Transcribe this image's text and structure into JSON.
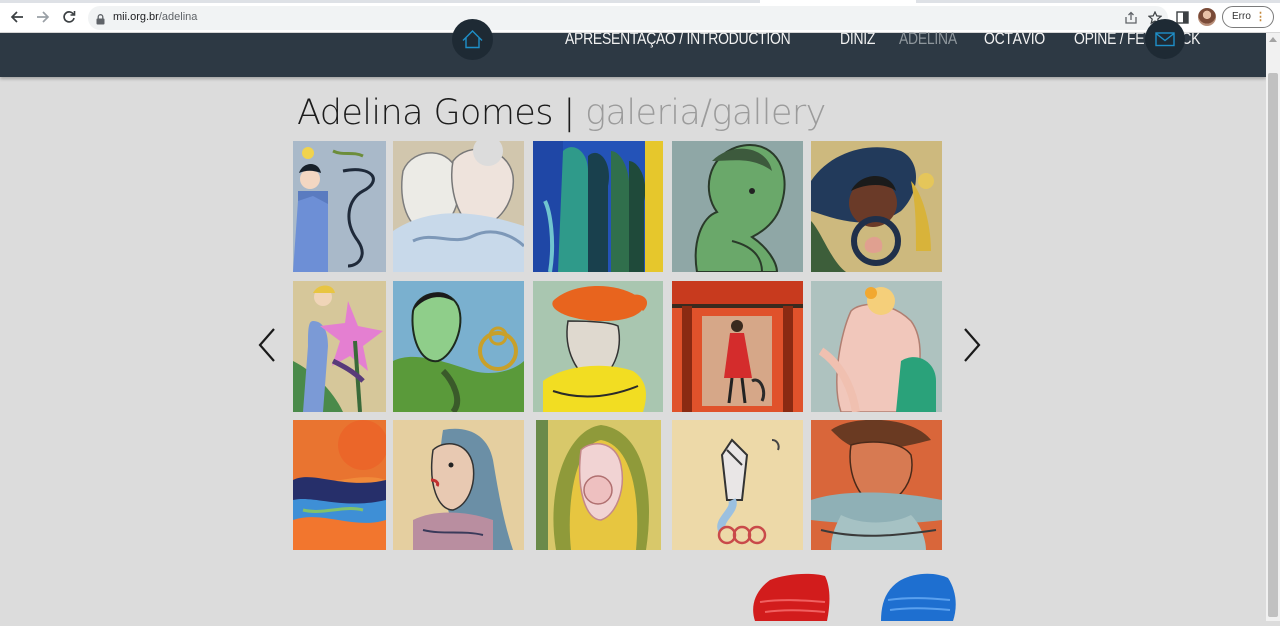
{
  "browser": {
    "url_host": "mii.org.br",
    "url_path": "/adelina",
    "error_label": "Erro"
  },
  "nav": {
    "links": [
      {
        "label": "APRESENTAÇÃO / INTRODUCTION",
        "active": false
      },
      {
        "label": "DINIZ",
        "active": false
      },
      {
        "label": "ADELINA",
        "active": true
      },
      {
        "label": "OCTÁVIO",
        "active": false
      },
      {
        "label": "OPINE / FEEDBACK",
        "active": false
      }
    ]
  },
  "page": {
    "title_name": "Adelina Gomes",
    "title_separator": "|",
    "title_gallery": "galeria/gallery"
  },
  "gallery": {
    "paintings": [
      "painting-woman-blue-dress",
      "painting-two-pale-faces",
      "painting-blue-green-figures",
      "painting-green-profile",
      "painting-dark-face-flowers",
      "painting-figure-pink-flower",
      "painting-green-face-vase",
      "painting-orange-turban-yellow",
      "painting-red-stage-dancer",
      "painting-pale-embrace",
      "painting-orange-sun-waves",
      "painting-profile-veil",
      "painting-mother-child",
      "painting-abstract-vase",
      "painting-woman-shawl"
    ]
  },
  "colors": {
    "nav_bg": "#2d3944",
    "page_bg": "#dcdcdc",
    "accent_red": "#d21c1c",
    "accent_blue": "#1e6fd0"
  }
}
